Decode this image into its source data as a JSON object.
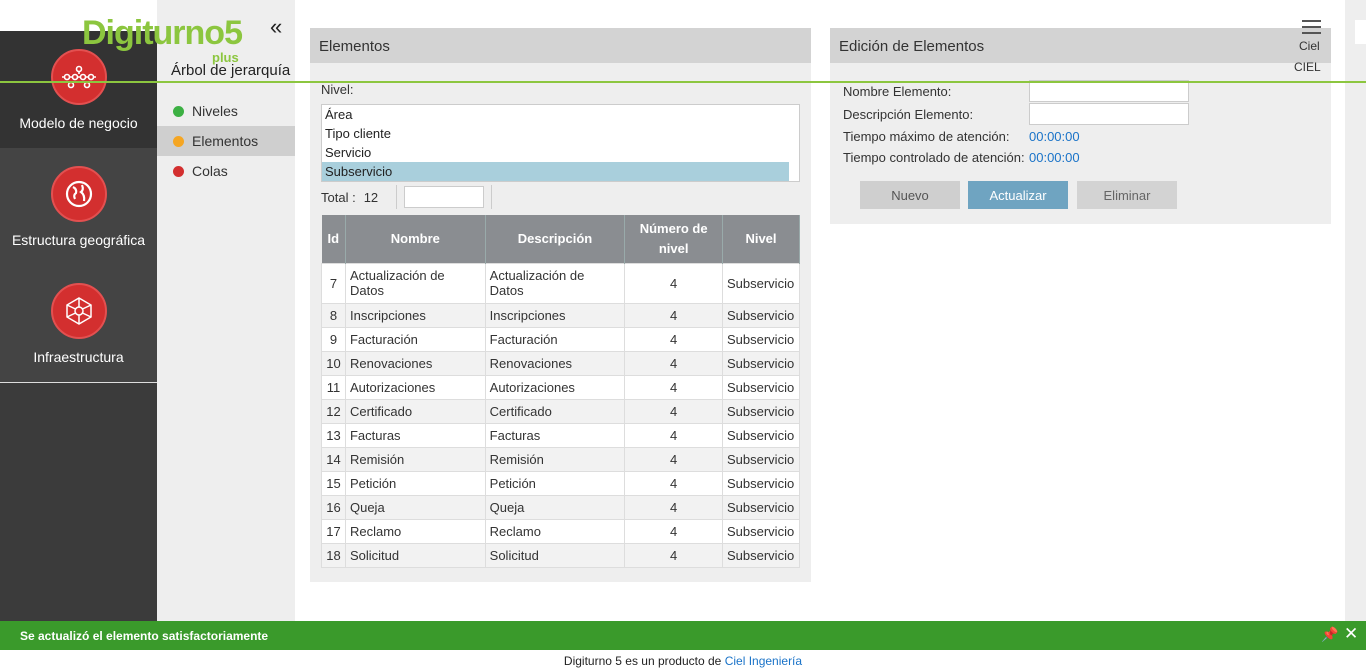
{
  "logo": {
    "brand": "Digiturno",
    "version": "5",
    "suffix": "plus"
  },
  "sidebar": {
    "items": [
      {
        "label": "Modelo de negocio",
        "icon": "network-node-icon"
      },
      {
        "label": "Estructura geográfica",
        "icon": "globe-icon"
      },
      {
        "label": "Infraestructura",
        "icon": "infrastructure-icon"
      }
    ]
  },
  "subnav": {
    "title": "Árbol de jerarquía",
    "items": [
      {
        "label": "Niveles",
        "color": "#3cb043"
      },
      {
        "label": "Elementos",
        "color": "#f5a623"
      },
      {
        "label": "Colas",
        "color": "#d32f2f"
      }
    ]
  },
  "user": {
    "short": "Ciel",
    "name": "CIEL"
  },
  "elementos": {
    "title": "Elementos",
    "nivel_label": "Nivel:",
    "nivel_options": [
      "Área",
      "Tipo cliente",
      "Servicio",
      "Subservicio"
    ],
    "nivel_selected": "Subservicio",
    "total_label": "Total :",
    "total_value": "12",
    "table": {
      "headers": [
        "Id",
        "Nombre",
        "Descripción",
        "Número de nivel",
        "Nivel"
      ],
      "rows": [
        [
          "7",
          "Actualización de Datos",
          "Actualización de Datos",
          "4",
          "Subservicio"
        ],
        [
          "8",
          "Inscripciones",
          "Inscripciones",
          "4",
          "Subservicio"
        ],
        [
          "9",
          "Facturación",
          "Facturación",
          "4",
          "Subservicio"
        ],
        [
          "10",
          "Renovaciones",
          "Renovaciones",
          "4",
          "Subservicio"
        ],
        [
          "11",
          "Autorizaciones",
          "Autorizaciones",
          "4",
          "Subservicio"
        ],
        [
          "12",
          "Certificado",
          "Certificado",
          "4",
          "Subservicio"
        ],
        [
          "13",
          "Facturas",
          "Facturas",
          "4",
          "Subservicio"
        ],
        [
          "14",
          "Remisión",
          "Remisión",
          "4",
          "Subservicio"
        ],
        [
          "15",
          "Petición",
          "Petición",
          "4",
          "Subservicio"
        ],
        [
          "16",
          "Queja",
          "Queja",
          "4",
          "Subservicio"
        ],
        [
          "17",
          "Reclamo",
          "Reclamo",
          "4",
          "Subservicio"
        ],
        [
          "18",
          "Solicitud",
          "Solicitud",
          "4",
          "Subservicio"
        ]
      ]
    }
  },
  "edicion": {
    "title": "Edición de Elementos",
    "nombre_label": "Nombre Elemento:",
    "nombre_value": "",
    "descripcion_label": "Descripción Elemento:",
    "descripcion_value": "",
    "tiempo_max_label": "Tiempo máximo de atención:",
    "tiempo_max_value": "00:00:00",
    "tiempo_ctl_label": "Tiempo controlado de atención:",
    "tiempo_ctl_value": "00:00:00",
    "buttons": {
      "nuevo": "Nuevo",
      "actualizar": "Actualizar",
      "eliminar": "Eliminar"
    }
  },
  "notification": {
    "message": "Se actualizó el elemento satisfactoriamente"
  },
  "footer": {
    "text": "Digiturno 5 es un producto de ",
    "link": "Ciel Ingeniería"
  },
  "colors": {
    "accent_green": "#8cc63f",
    "notif_green": "#3a9a2b",
    "icon_red": "#d32f2f",
    "button_blue": "#6fa4c1"
  }
}
